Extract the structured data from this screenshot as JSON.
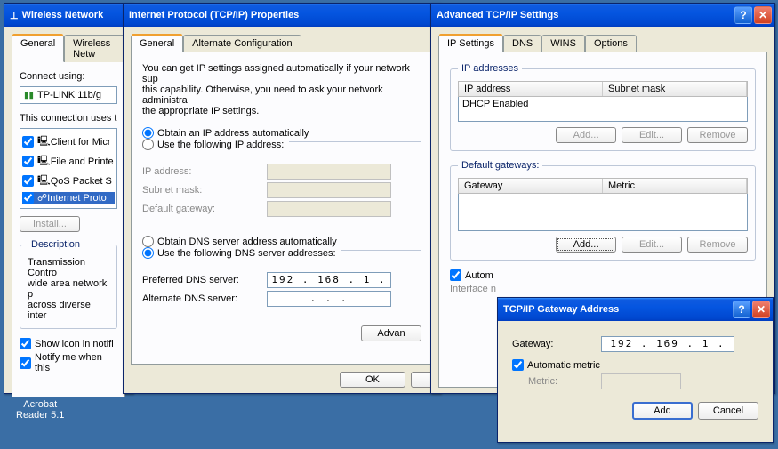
{
  "desktop": {
    "acrobat": "Acrobat\nReader 5.1"
  },
  "win1": {
    "title": "Wireless Network",
    "tabs": {
      "general": "General",
      "wireless": "Wireless Netw"
    },
    "connect_label": "Connect using:",
    "adapter": "TP-LINK 11b/g",
    "uses_label": "This connection uses t",
    "items": [
      "Client for Micr",
      "File and Printe",
      "QoS Packet S",
      "Internet Proto"
    ],
    "install": "Install...",
    "desc_h": "Description",
    "desc": "Transmission Contro\nwide area network p\nacross diverse inter",
    "show_icon": "Show icon in notifi",
    "notify": "Notify me when this"
  },
  "win2": {
    "title": "Internet Protocol (TCP/IP) Properties",
    "tabs": {
      "general": "General",
      "alt": "Alternate Configuration"
    },
    "blurb": "You can get IP settings assigned automatically if your network sup\nthis capability. Otherwise, you need to ask your network administra\nthe appropriate IP settings.",
    "r_auto_ip": "Obtain an IP address automatically",
    "r_use_ip": "Use the following IP address:",
    "ip": "IP address:",
    "subnet": "Subnet mask:",
    "gateway": "Default gateway:",
    "r_auto_dns": "Obtain DNS server address automatically",
    "r_use_dns": "Use the following DNS server addresses:",
    "pref_dns": "Preferred DNS server:",
    "pref_dns_val": "192 . 168 .  1  .",
    "alt_dns": "Alternate DNS server:",
    "alt_dns_val": ".       .       .",
    "advanced": "Advan",
    "ok": "OK"
  },
  "win3": {
    "title": "Advanced TCP/IP Settings",
    "tabs": {
      "ip": "IP Settings",
      "dns": "DNS",
      "wins": "WINS",
      "opt": "Options"
    },
    "grp_ip": "IP addresses",
    "col_ip": "IP address",
    "col_mask": "Subnet mask",
    "dhcp": "DHCP Enabled",
    "grp_gw": "Default gateways:",
    "col_gw": "Gateway",
    "col_metric": "Metric",
    "add": "Add...",
    "edit": "Edit...",
    "remove": "Remove",
    "autom": "Autom",
    "iface": "Interface n"
  },
  "win4": {
    "title": "TCP/IP Gateway Address",
    "gw_label": "Gateway:",
    "gw_val": "192 . 169 .  1  .",
    "auto_metric": "Automatic metric",
    "metric": "Metric:",
    "add": "Add",
    "cancel": "Cancel"
  }
}
